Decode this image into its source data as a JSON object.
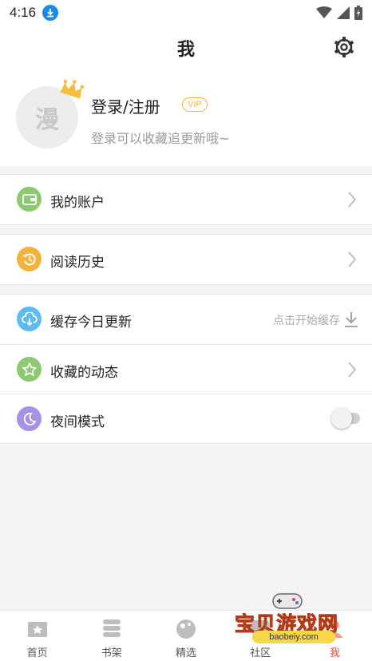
{
  "status_bar": {
    "time": "4:16"
  },
  "header": {
    "title": "我"
  },
  "profile": {
    "avatar_text": "漫",
    "login_label": "登录/注册",
    "vip_badge": "VIP",
    "subtitle": "登录可以收藏追更新哦~"
  },
  "menu": {
    "account": "我的账户",
    "history": "阅读历史",
    "cache": "缓存今日更新",
    "cache_hint": "点击开始缓存",
    "favorites": "收藏的动态",
    "night_mode": "夜间模式",
    "night_mode_on": false
  },
  "tabs": [
    {
      "label": "首页",
      "icon": "home-icon"
    },
    {
      "label": "书架",
      "icon": "bookshelf-icon"
    },
    {
      "label": "精选",
      "icon": "featured-icon"
    },
    {
      "label": "社区",
      "icon": "community-icon"
    },
    {
      "label": "我",
      "icon": "profile-icon"
    }
  ],
  "active_tab": "我",
  "watermark": {
    "title": "宝贝游戏网",
    "url": "baobeiy.com"
  },
  "colors": {
    "accent": "#ef4a2b",
    "account_icon": "#8dc96f",
    "history_icon": "#f3b23c",
    "cache_icon": "#5cbcf2",
    "favorites_icon": "#8dc96f",
    "night_icon": "#a592e6",
    "vip": "#f3b234"
  }
}
